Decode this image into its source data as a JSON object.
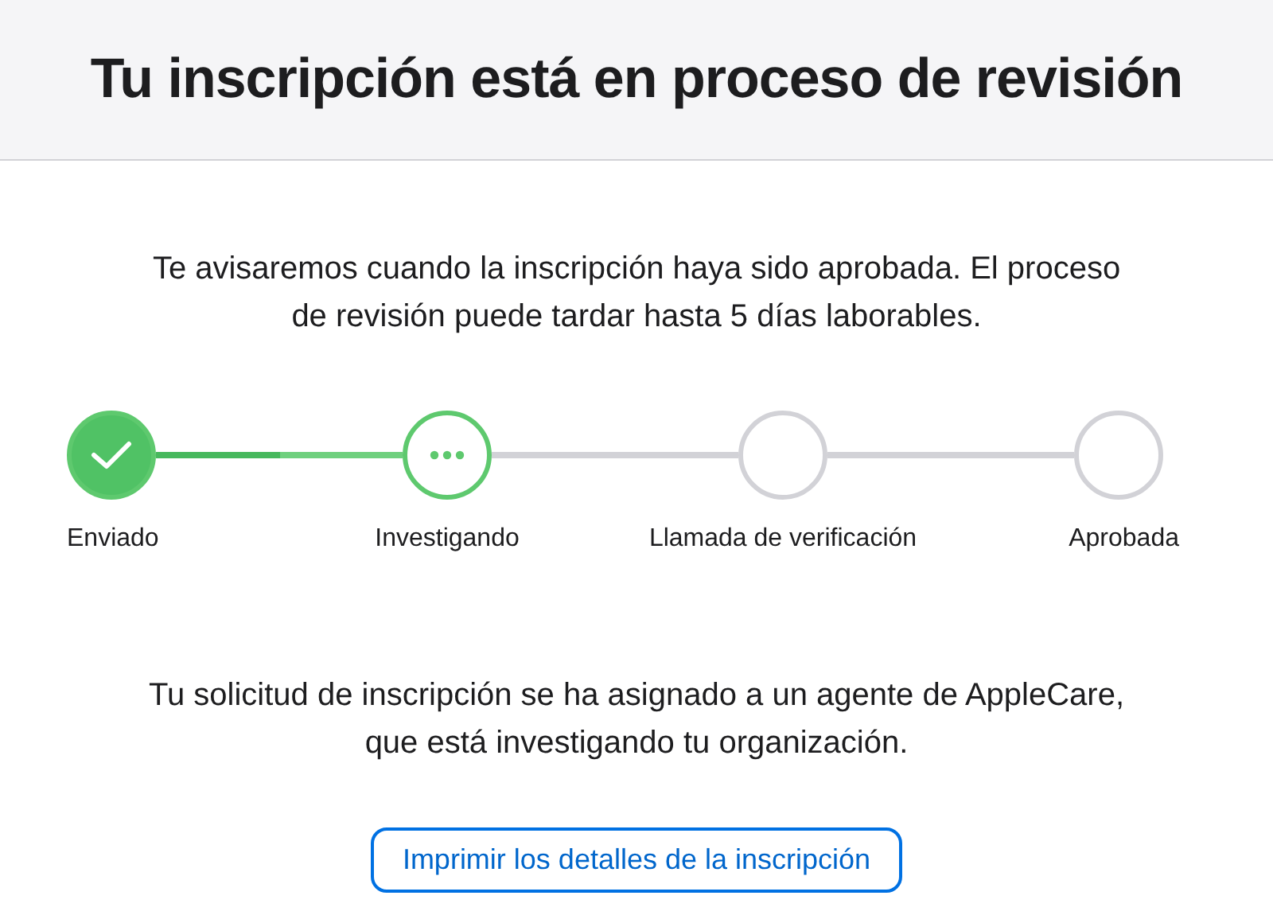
{
  "header": {
    "title": "Tu inscripción está en proceso de revisión"
  },
  "intro": "Te avisaremos cuando la inscripción haya sido aprobada. El proceso de revisión puede tardar hasta 5 días laborables.",
  "steps": [
    {
      "label": "Enviado",
      "kind": "done"
    },
    {
      "label": "Investigando",
      "kind": "current",
      "connector": {
        "level": 0.5
      }
    },
    {
      "label": "Llamada de verificación",
      "kind": "pending"
    },
    {
      "label": "Aprobada",
      "kind": "pending"
    }
  ],
  "message": "Tu solicitud de inscripción se ha asignado a un agente de AppleCare, que está investigando tu organización.",
  "button": "Imprimir los detalles de la inscripción"
}
